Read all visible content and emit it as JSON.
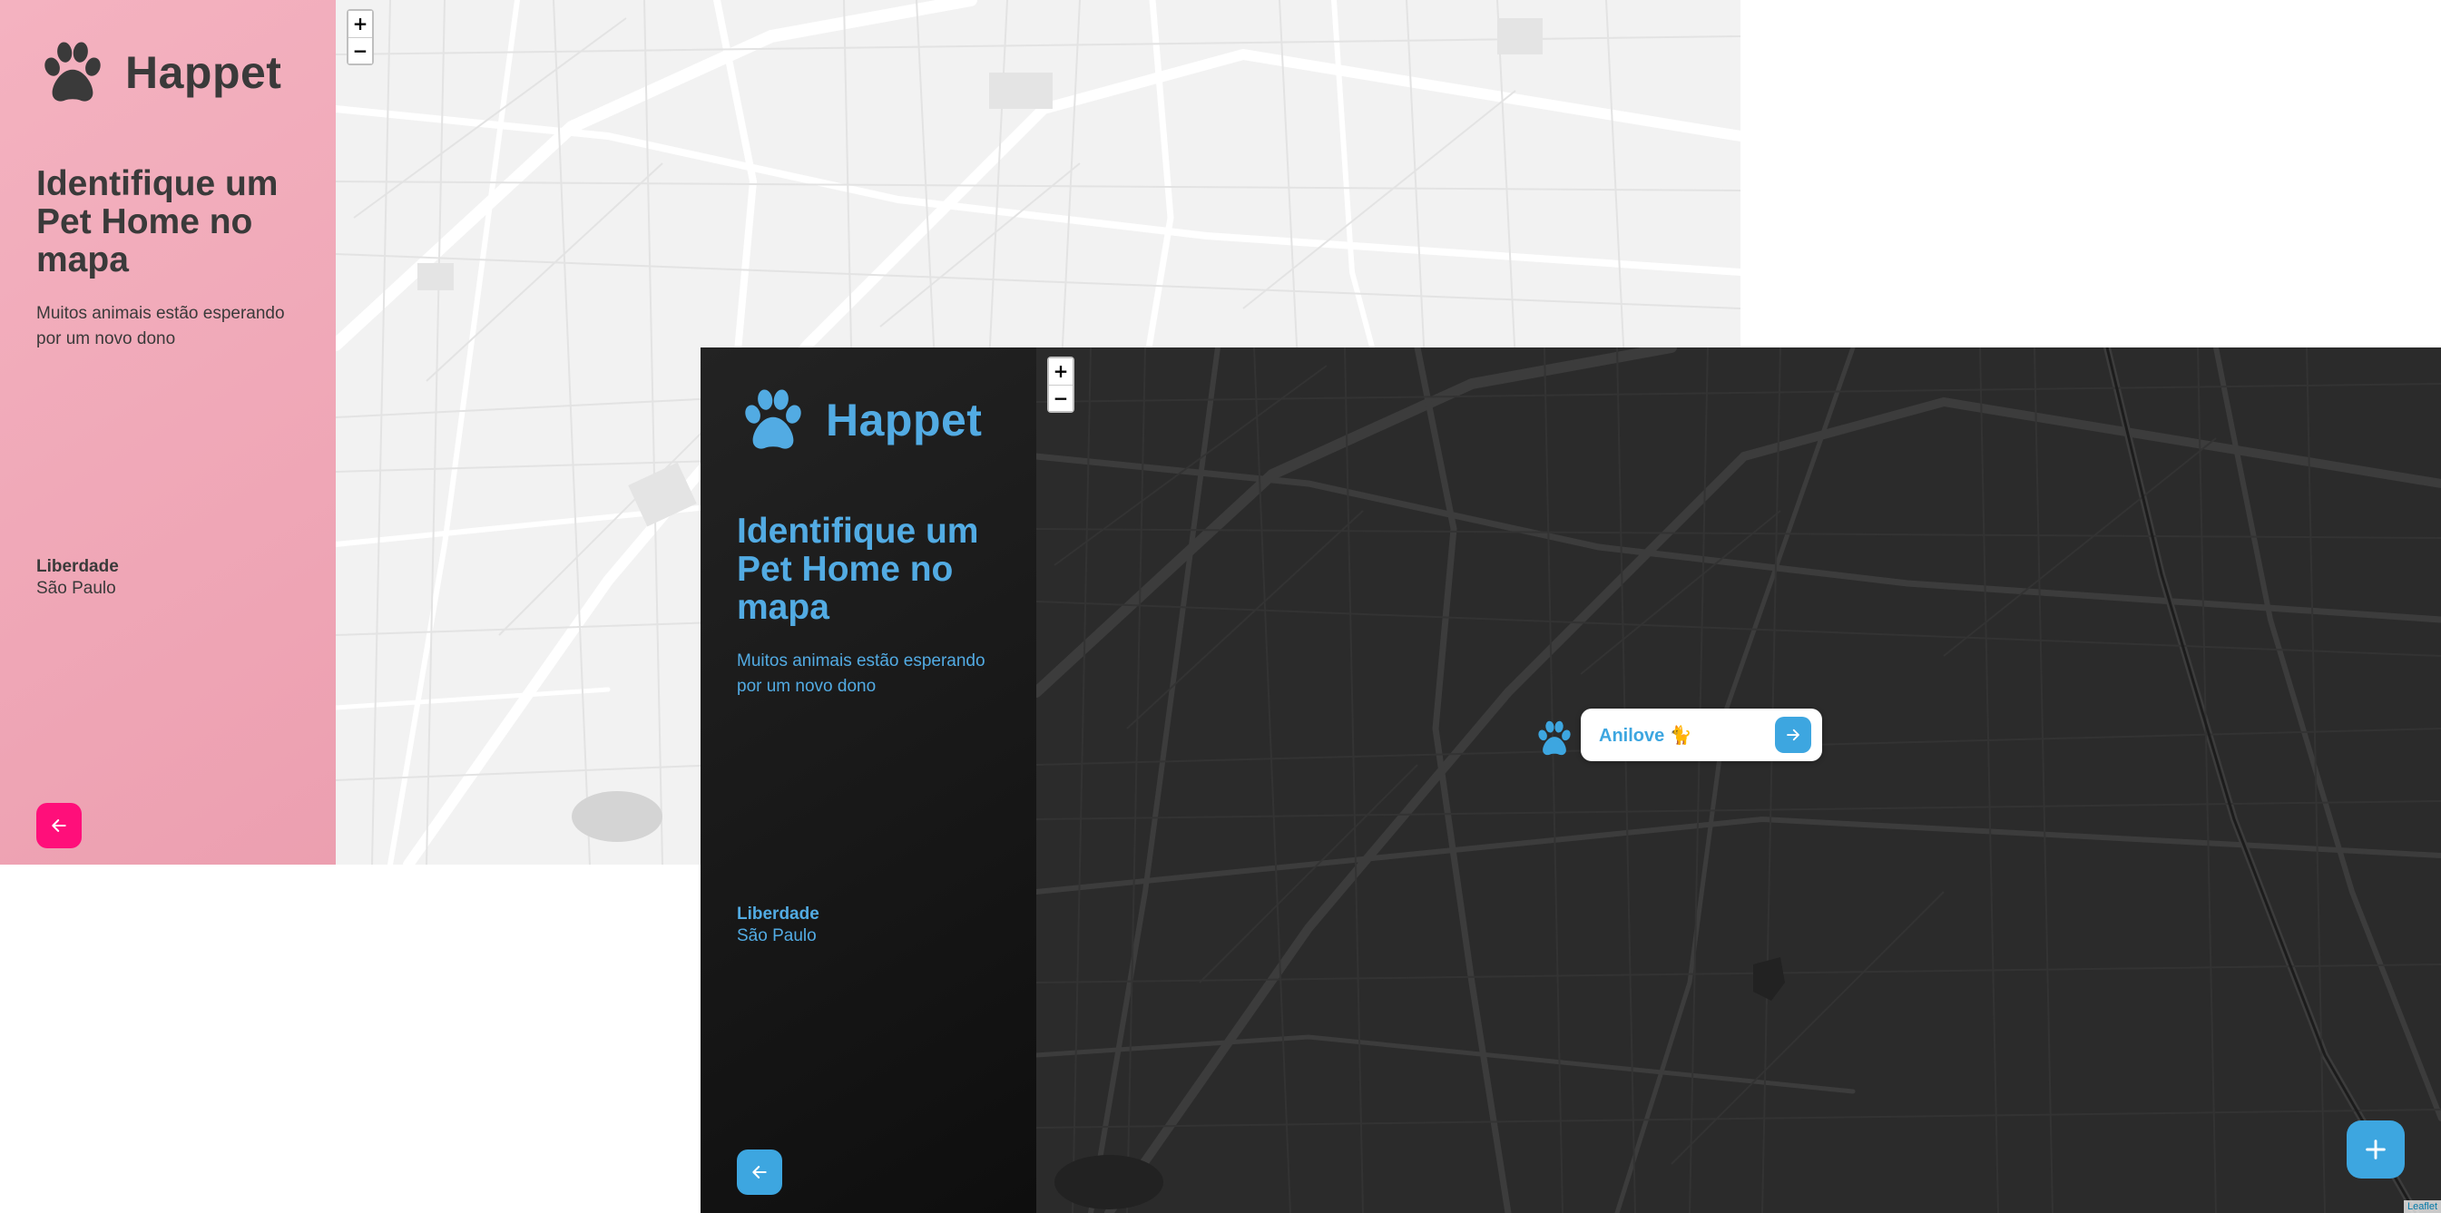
{
  "screens": [
    {
      "theme": "light",
      "brand": "Happet",
      "headline": "Identifique um Pet Home no mapa",
      "subtitle": "Muitos animais estão esperando por um novo dono",
      "location": {
        "city": "Liberdade",
        "state": "São Paulo"
      },
      "zoom": {
        "in": "+",
        "out": "−"
      },
      "icons": {
        "logo": "paw-icon",
        "back": "arrow-left-icon"
      },
      "colors": {
        "sidebar": "#f2abbb",
        "accent": "#ff0f7a",
        "text": "#3a3a3a"
      }
    },
    {
      "theme": "dark",
      "brand": "Happet",
      "headline": "Identifique um Pet Home no mapa",
      "subtitle": "Muitos animais estão esperando por um novo dono",
      "location": {
        "city": "Liberdade",
        "state": "São Paulo"
      },
      "zoom": {
        "in": "+",
        "out": "−"
      },
      "popup": {
        "name": "Anilove 🐈"
      },
      "add_button": "+",
      "attribution": "Leaflet",
      "icons": {
        "logo": "paw-icon",
        "back": "arrow-left-icon",
        "marker": "paw-marker-icon",
        "popup": "arrow-right-icon",
        "add": "plus-icon"
      },
      "colors": {
        "sidebar": "#151515",
        "accent": "#3da6e0",
        "text": "#52abe3"
      }
    }
  ]
}
